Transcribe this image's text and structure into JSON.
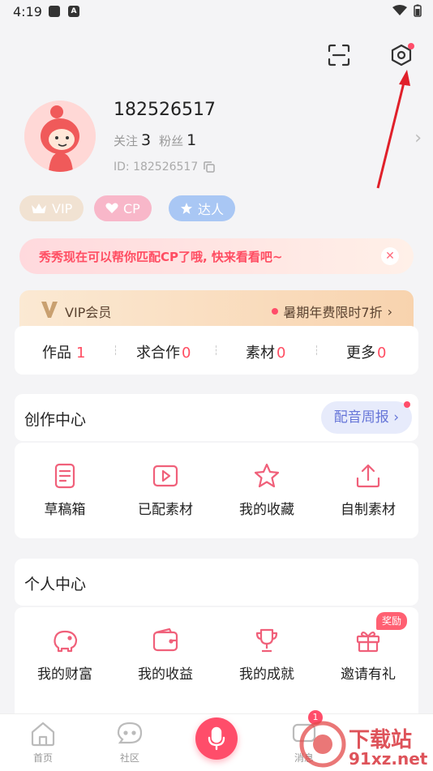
{
  "status_bar": {
    "time": "4:19",
    "a_icon_label": "A"
  },
  "profile": {
    "username": "182526517",
    "follow_label": "关注",
    "follow_count": "3",
    "fans_label": "粉丝",
    "fans_count": "1",
    "id_text": "ID: 182526517"
  },
  "badges": {
    "vip": "VIP",
    "cp": "CP",
    "daren": "达人"
  },
  "banner": {
    "text": "秀秀现在可以帮你匹配CP了哦, 快来看看吧~"
  },
  "vip_strip": {
    "title": "VIP会员",
    "offer": "暑期年费限时7折"
  },
  "works": [
    {
      "label": "作品",
      "count": "1"
    },
    {
      "label": "求合作",
      "count": "0"
    },
    {
      "label": "素材",
      "count": "0"
    },
    {
      "label": "更多",
      "count": "0"
    }
  ],
  "creation": {
    "title": "创作中心",
    "weekly_button": "配音周报",
    "items": [
      {
        "label": "草稿箱",
        "icon": "draft-icon"
      },
      {
        "label": "已配素材",
        "icon": "video-icon"
      },
      {
        "label": "我的收藏",
        "icon": "star-icon"
      },
      {
        "label": "自制素材",
        "icon": "upload-icon"
      }
    ]
  },
  "personal": {
    "title": "个人中心",
    "reward_badge": "奖励",
    "items": [
      {
        "label": "我的财富",
        "icon": "piggy-bank-icon"
      },
      {
        "label": "我的收益",
        "icon": "wallet-icon"
      },
      {
        "label": "我的成就",
        "icon": "trophy-icon"
      },
      {
        "label": "邀请有礼",
        "icon": "gift-icon"
      }
    ]
  },
  "tab_bar": {
    "home": "首页",
    "community": "社区",
    "messages": "消息",
    "message_badge": "1"
  },
  "watermark": {
    "main": "下载站",
    "domain": "91xz.net"
  },
  "colors": {
    "accent": "#ff4d6a",
    "icon_red": "#f0607a",
    "weekly_blue": "#6675d8"
  }
}
